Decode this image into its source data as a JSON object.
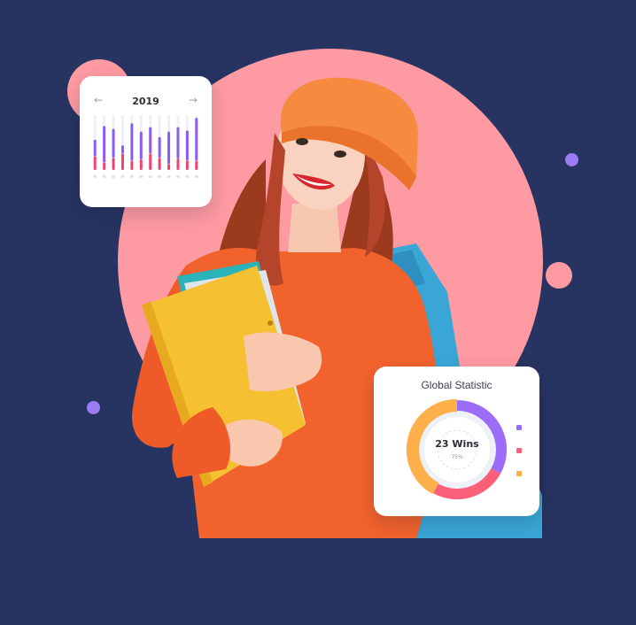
{
  "calendar": {
    "year": "2019",
    "prev_icon": "arrow-left-icon",
    "next_icon": "arrow-right-icon",
    "bar_values_top": [
      0.55,
      0.8,
      0.75,
      0.45,
      0.85,
      0.7,
      0.78,
      0.6,
      0.7,
      0.78,
      0.72,
      0.95
    ],
    "bar_values_bottom": [
      0.45,
      0.25,
      0.4,
      0.55,
      0.3,
      0.35,
      0.55,
      0.4,
      0.2,
      0.38,
      0.32,
      0.3
    ],
    "colors": {
      "top": "#8a5cf5",
      "bottom": "#f0436f"
    }
  },
  "statistic": {
    "title": "Global Statistic",
    "wins": "23 Wins",
    "percent": "75%",
    "segments": [
      {
        "value": 0.33,
        "color": "#9b6cf8"
      },
      {
        "value": 0.25,
        "color": "#fb5f79"
      },
      {
        "value": 0.42,
        "color": "#ffb04a"
      }
    ],
    "legend_colors": [
      "#9b6cf8",
      "#fb5f79",
      "#ffb04a"
    ]
  },
  "colors": {
    "background": "#273360",
    "accent_pink": "#fe9aa2",
    "accent_purple": "#9b7cf5"
  }
}
